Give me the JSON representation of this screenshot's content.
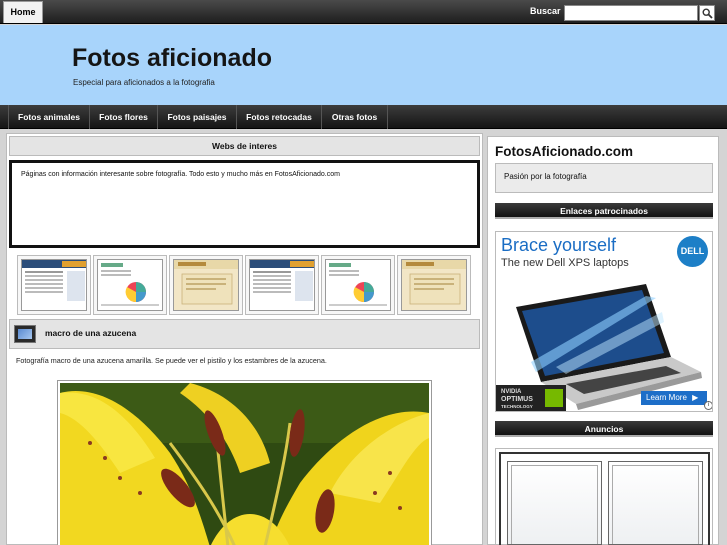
{
  "topbar": {
    "home_label": "Home",
    "search_label": "Buscar",
    "search_value": ""
  },
  "header": {
    "title": "Fotos aficionado",
    "tagline": "Especial para aficionados a la fotografia"
  },
  "nav": {
    "items": [
      "Fotos animales",
      "Fotos flores",
      "Fotos paisajes",
      "Fotos retocadas",
      "Otras fotos"
    ]
  },
  "main": {
    "webs_heading": "Webs de interes",
    "webs_text": "Páginas con información interesante sobre fotografía. Todo esto y mucho más en FotosAficionado.com",
    "post": {
      "title": "macro de una azucena",
      "text": "Fotografía macro de una azucena amarilla. Se puede ver el pistilo y los estambres de la azucena."
    }
  },
  "sidebar": {
    "site_name": "FotosAficionado.com",
    "site_desc": "Pasión por la fotografía",
    "sponsored_heading": "Enlaces patrocinados",
    "ad": {
      "headline": "Brace yourself",
      "subline": "The new Dell XPS laptops",
      "brand": "DELL",
      "badge_text": [
        "NVIDIA",
        "OPTIMUS",
        "TECHNOLOGY"
      ],
      "cta": "Learn More",
      "info_icon": "i"
    },
    "ads_heading": "Anuncios"
  },
  "colors": {
    "header_bg": "#a8d4fb",
    "nav_bg": "#1e1e1e",
    "ad_blue": "#1a6dc4",
    "lily_yellow": "#f5dc2a"
  }
}
